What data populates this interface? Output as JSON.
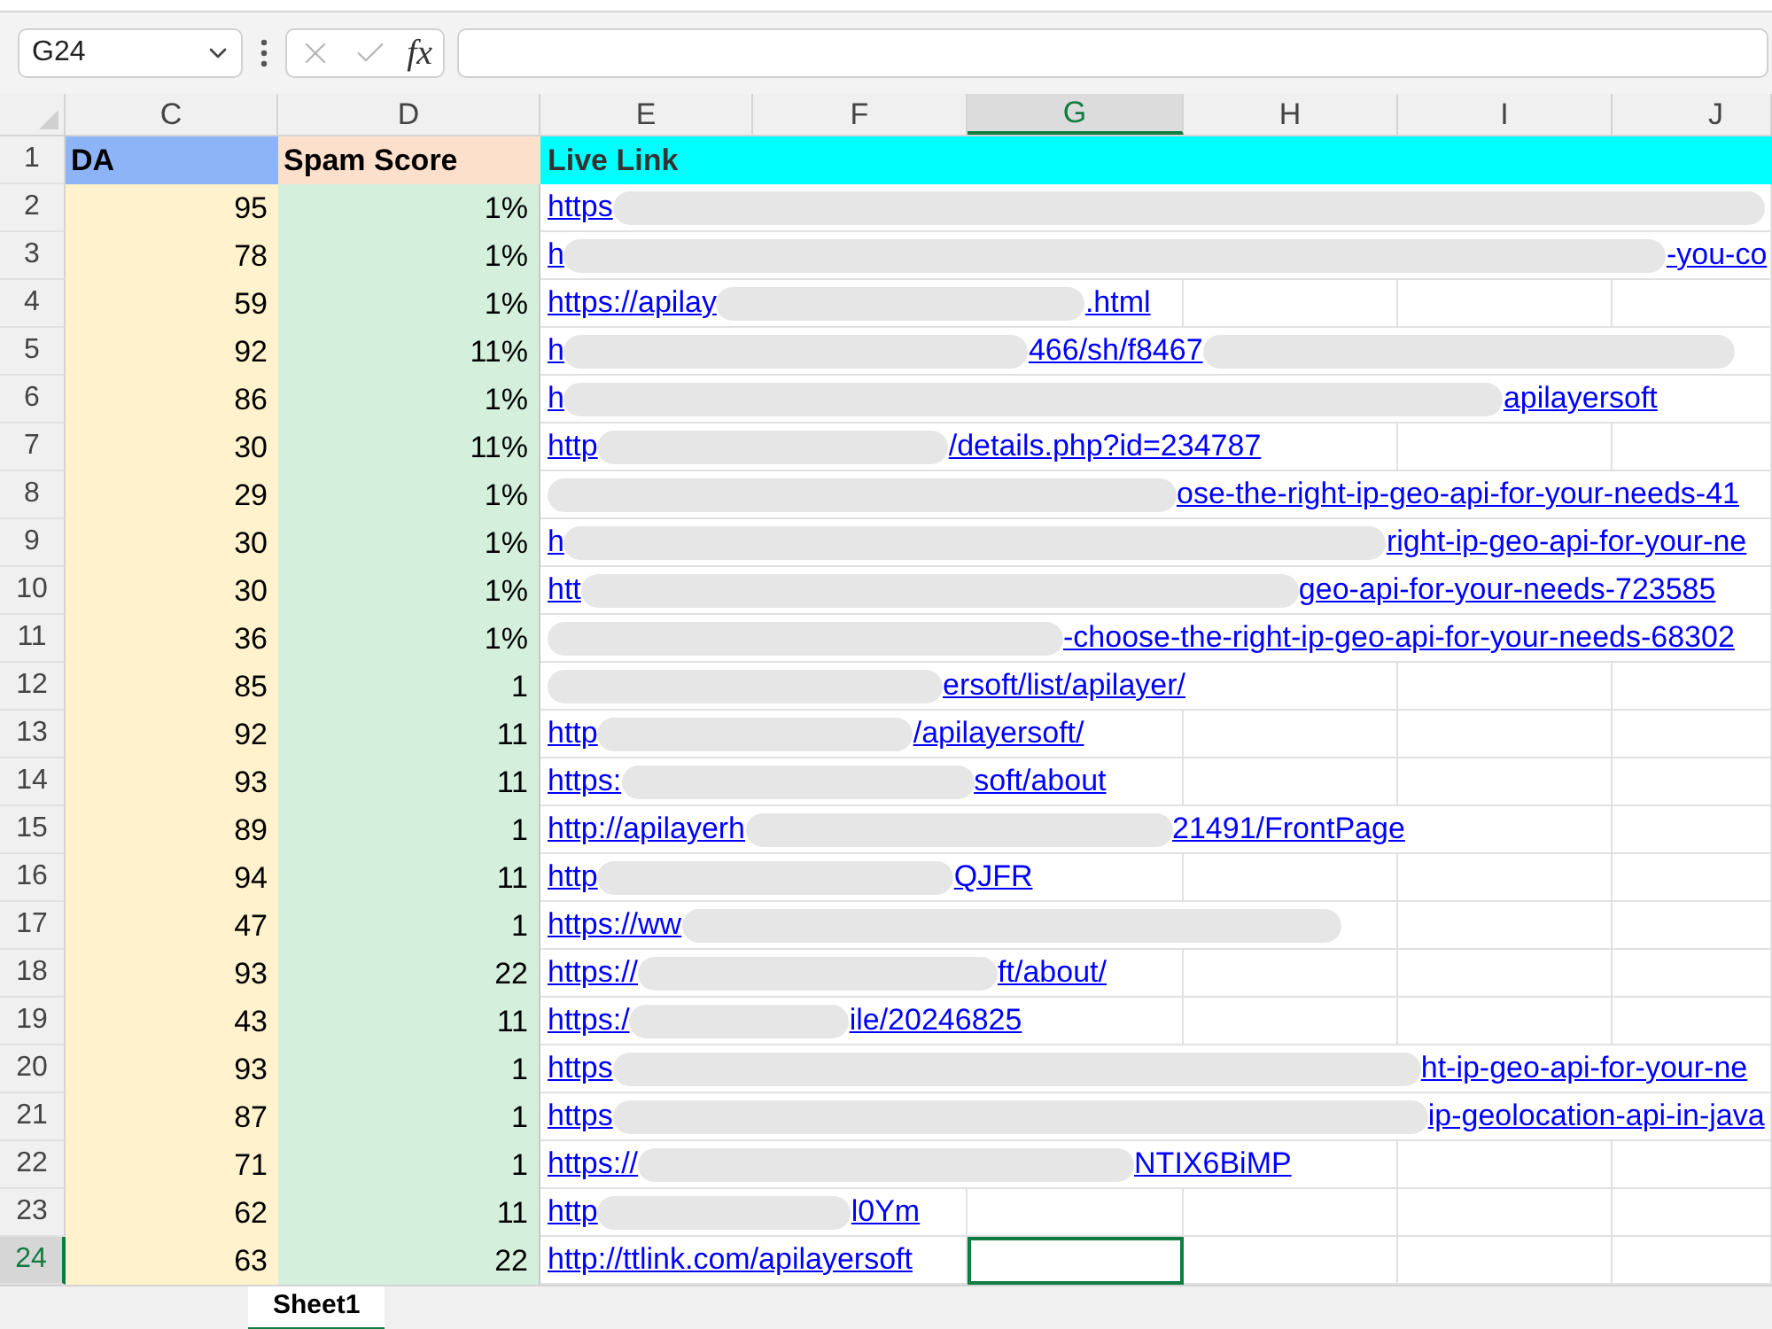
{
  "formula_bar": {
    "name_box": "G24",
    "function_label": "fx"
  },
  "columns": [
    {
      "label": "C",
      "selected": false
    },
    {
      "label": "D",
      "selected": false
    },
    {
      "label": "E",
      "selected": false
    },
    {
      "label": "F",
      "selected": false
    },
    {
      "label": "G",
      "selected": true
    },
    {
      "label": "H",
      "selected": false
    },
    {
      "label": "I",
      "selected": false
    },
    {
      "label": "J",
      "selected": false
    }
  ],
  "header_row": {
    "number": "1",
    "selected": false,
    "cells": [
      "DA",
      "Spam Score",
      "Live Link"
    ]
  },
  "rows": [
    {
      "number": "2",
      "selected": false,
      "da": "95",
      "spam_score": "1%",
      "link": [
        {
          "kind": "text",
          "text": "https"
        },
        {
          "kind": "redacted"
        }
      ]
    },
    {
      "number": "3",
      "selected": false,
      "da": "78",
      "spam_score": "1%",
      "link": [
        {
          "kind": "text",
          "text": "h"
        },
        {
          "kind": "redacted"
        },
        {
          "kind": "text",
          "text": "-you-co"
        }
      ]
    },
    {
      "number": "4",
      "selected": false,
      "da": "59",
      "spam_score": "1%",
      "link": [
        {
          "kind": "text",
          "text": "https://apilay"
        },
        {
          "kind": "redacted"
        },
        {
          "kind": "text",
          "text": ".html"
        }
      ]
    },
    {
      "number": "5",
      "selected": false,
      "da": "92",
      "spam_score": "11%",
      "link": [
        {
          "kind": "text",
          "text": "h"
        },
        {
          "kind": "redacted"
        },
        {
          "kind": "text",
          "text": "466/sh/f8467"
        },
        {
          "kind": "redacted"
        }
      ]
    },
    {
      "number": "6",
      "selected": false,
      "da": "86",
      "spam_score": "1%",
      "link": [
        {
          "kind": "text",
          "text": "h"
        },
        {
          "kind": "redacted"
        },
        {
          "kind": "text",
          "text": "apilayersoft"
        }
      ]
    },
    {
      "number": "7",
      "selected": false,
      "da": "30",
      "spam_score": "11%",
      "link": [
        {
          "kind": "text",
          "text": "http"
        },
        {
          "kind": "redacted"
        },
        {
          "kind": "text",
          "text": "/details.php?id=234787"
        }
      ]
    },
    {
      "number": "8",
      "selected": false,
      "da": "29",
      "spam_score": "1%",
      "link": [
        {
          "kind": "redacted"
        },
        {
          "kind": "text",
          "text": "ose-the-right-ip-geo-api-for-your-needs-41"
        }
      ]
    },
    {
      "number": "9",
      "selected": false,
      "da": "30",
      "spam_score": "1%",
      "link": [
        {
          "kind": "text",
          "text": "h"
        },
        {
          "kind": "redacted"
        },
        {
          "kind": "text",
          "text": "right-ip-geo-api-for-your-ne"
        }
      ]
    },
    {
      "number": "10",
      "selected": false,
      "da": "30",
      "spam_score": "1%",
      "link": [
        {
          "kind": "text",
          "text": "htt"
        },
        {
          "kind": "redacted"
        },
        {
          "kind": "text",
          "text": "geo-api-for-your-needs-723585"
        }
      ]
    },
    {
      "number": "11",
      "selected": false,
      "da": "36",
      "spam_score": "1%",
      "link": [
        {
          "kind": "redacted"
        },
        {
          "kind": "text",
          "text": "-choose-the-right-ip-geo-api-for-your-needs-68302"
        }
      ]
    },
    {
      "number": "12",
      "selected": false,
      "da": "85",
      "spam_score": "1",
      "link": [
        {
          "kind": "redacted"
        },
        {
          "kind": "text",
          "text": "ersoft/list/apilayer/"
        }
      ]
    },
    {
      "number": "13",
      "selected": false,
      "da": "92",
      "spam_score": "11",
      "link": [
        {
          "kind": "text",
          "text": "http"
        },
        {
          "kind": "redacted"
        },
        {
          "kind": "text",
          "text": "/apilayersoft/"
        }
      ]
    },
    {
      "number": "14",
      "selected": false,
      "da": "93",
      "spam_score": "11",
      "link": [
        {
          "kind": "text",
          "text": "https:"
        },
        {
          "kind": "redacted"
        },
        {
          "kind": "text",
          "text": "soft/about"
        }
      ]
    },
    {
      "number": "15",
      "selected": false,
      "da": "89",
      "spam_score": "1",
      "link": [
        {
          "kind": "text",
          "text": "http://apilayerh"
        },
        {
          "kind": "redacted"
        },
        {
          "kind": "text",
          "text": "21491/FrontPage"
        }
      ]
    },
    {
      "number": "16",
      "selected": false,
      "da": "94",
      "spam_score": "11",
      "link": [
        {
          "kind": "text",
          "text": "http"
        },
        {
          "kind": "redacted"
        },
        {
          "kind": "text",
          "text": "QJFR"
        }
      ]
    },
    {
      "number": "17",
      "selected": false,
      "da": "47",
      "spam_score": "1",
      "link": [
        {
          "kind": "text",
          "text": "https://ww"
        },
        {
          "kind": "redacted"
        }
      ]
    },
    {
      "number": "18",
      "selected": false,
      "da": "93",
      "spam_score": "22",
      "link": [
        {
          "kind": "text",
          "text": "https://"
        },
        {
          "kind": "redacted"
        },
        {
          "kind": "text",
          "text": "ft/about/"
        }
      ]
    },
    {
      "number": "19",
      "selected": false,
      "da": "43",
      "spam_score": "11",
      "link": [
        {
          "kind": "text",
          "text": "https:/"
        },
        {
          "kind": "redacted"
        },
        {
          "kind": "text",
          "text": "ile/20246825"
        }
      ]
    },
    {
      "number": "20",
      "selected": false,
      "da": "93",
      "spam_score": "1",
      "link": [
        {
          "kind": "text",
          "text": "https"
        },
        {
          "kind": "redacted"
        },
        {
          "kind": "text",
          "text": "ht-ip-geo-api-for-your-ne"
        }
      ]
    },
    {
      "number": "21",
      "selected": false,
      "da": "87",
      "spam_score": "1",
      "link": [
        {
          "kind": "text",
          "text": "https"
        },
        {
          "kind": "redacted"
        },
        {
          "kind": "text",
          "text": "ip-geolocation-api-in-java"
        }
      ]
    },
    {
      "number": "22",
      "selected": false,
      "da": "71",
      "spam_score": "1",
      "link": [
        {
          "kind": "text",
          "text": "https://"
        },
        {
          "kind": "redacted"
        },
        {
          "kind": "text",
          "text": "NTIX6BiMP"
        }
      ]
    },
    {
      "number": "23",
      "selected": false,
      "da": "62",
      "spam_score": "11",
      "link": [
        {
          "kind": "text",
          "text": "http"
        },
        {
          "kind": "redacted"
        },
        {
          "kind": "text",
          "text": "l0Ym"
        }
      ]
    },
    {
      "number": "24",
      "selected": true,
      "da": "63",
      "spam_score": "22",
      "link": [
        {
          "kind": "text",
          "text": "http://ttlink.com/apilayersoft"
        }
      ]
    }
  ],
  "sheet_tabs": [
    {
      "label": "Sheet1",
      "selected": true
    }
  ]
}
